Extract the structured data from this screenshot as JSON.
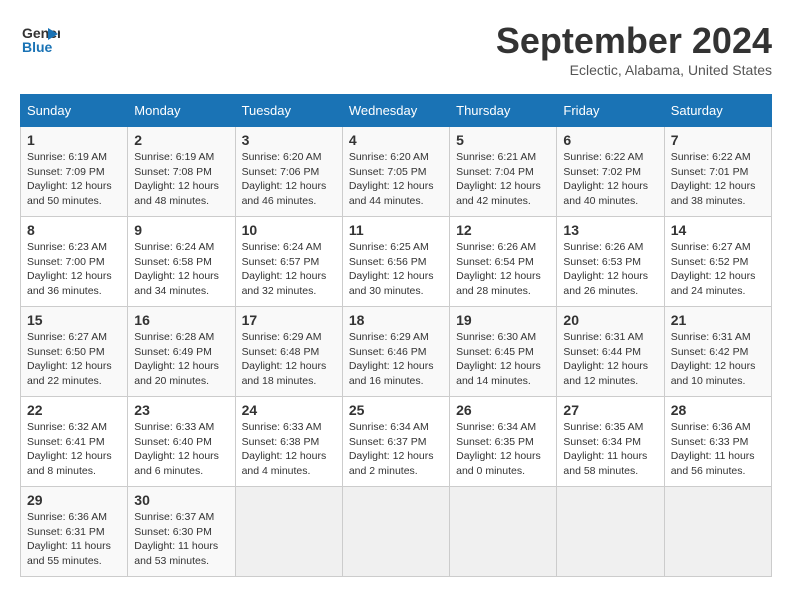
{
  "logo": {
    "line1": "General",
    "line2": "Blue"
  },
  "title": "September 2024",
  "location": "Eclectic, Alabama, United States",
  "days_of_week": [
    "Sunday",
    "Monday",
    "Tuesday",
    "Wednesday",
    "Thursday",
    "Friday",
    "Saturday"
  ],
  "weeks": [
    [
      {
        "day": "1",
        "info": "Sunrise: 6:19 AM\nSunset: 7:09 PM\nDaylight: 12 hours\nand 50 minutes."
      },
      {
        "day": "2",
        "info": "Sunrise: 6:19 AM\nSunset: 7:08 PM\nDaylight: 12 hours\nand 48 minutes."
      },
      {
        "day": "3",
        "info": "Sunrise: 6:20 AM\nSunset: 7:06 PM\nDaylight: 12 hours\nand 46 minutes."
      },
      {
        "day": "4",
        "info": "Sunrise: 6:20 AM\nSunset: 7:05 PM\nDaylight: 12 hours\nand 44 minutes."
      },
      {
        "day": "5",
        "info": "Sunrise: 6:21 AM\nSunset: 7:04 PM\nDaylight: 12 hours\nand 42 minutes."
      },
      {
        "day": "6",
        "info": "Sunrise: 6:22 AM\nSunset: 7:02 PM\nDaylight: 12 hours\nand 40 minutes."
      },
      {
        "day": "7",
        "info": "Sunrise: 6:22 AM\nSunset: 7:01 PM\nDaylight: 12 hours\nand 38 minutes."
      }
    ],
    [
      {
        "day": "8",
        "info": "Sunrise: 6:23 AM\nSunset: 7:00 PM\nDaylight: 12 hours\nand 36 minutes."
      },
      {
        "day": "9",
        "info": "Sunrise: 6:24 AM\nSunset: 6:58 PM\nDaylight: 12 hours\nand 34 minutes."
      },
      {
        "day": "10",
        "info": "Sunrise: 6:24 AM\nSunset: 6:57 PM\nDaylight: 12 hours\nand 32 minutes."
      },
      {
        "day": "11",
        "info": "Sunrise: 6:25 AM\nSunset: 6:56 PM\nDaylight: 12 hours\nand 30 minutes."
      },
      {
        "day": "12",
        "info": "Sunrise: 6:26 AM\nSunset: 6:54 PM\nDaylight: 12 hours\nand 28 minutes."
      },
      {
        "day": "13",
        "info": "Sunrise: 6:26 AM\nSunset: 6:53 PM\nDaylight: 12 hours\nand 26 minutes."
      },
      {
        "day": "14",
        "info": "Sunrise: 6:27 AM\nSunset: 6:52 PM\nDaylight: 12 hours\nand 24 minutes."
      }
    ],
    [
      {
        "day": "15",
        "info": "Sunrise: 6:27 AM\nSunset: 6:50 PM\nDaylight: 12 hours\nand 22 minutes."
      },
      {
        "day": "16",
        "info": "Sunrise: 6:28 AM\nSunset: 6:49 PM\nDaylight: 12 hours\nand 20 minutes."
      },
      {
        "day": "17",
        "info": "Sunrise: 6:29 AM\nSunset: 6:48 PM\nDaylight: 12 hours\nand 18 minutes."
      },
      {
        "day": "18",
        "info": "Sunrise: 6:29 AM\nSunset: 6:46 PM\nDaylight: 12 hours\nand 16 minutes."
      },
      {
        "day": "19",
        "info": "Sunrise: 6:30 AM\nSunset: 6:45 PM\nDaylight: 12 hours\nand 14 minutes."
      },
      {
        "day": "20",
        "info": "Sunrise: 6:31 AM\nSunset: 6:44 PM\nDaylight: 12 hours\nand 12 minutes."
      },
      {
        "day": "21",
        "info": "Sunrise: 6:31 AM\nSunset: 6:42 PM\nDaylight: 12 hours\nand 10 minutes."
      }
    ],
    [
      {
        "day": "22",
        "info": "Sunrise: 6:32 AM\nSunset: 6:41 PM\nDaylight: 12 hours\nand 8 minutes."
      },
      {
        "day": "23",
        "info": "Sunrise: 6:33 AM\nSunset: 6:40 PM\nDaylight: 12 hours\nand 6 minutes."
      },
      {
        "day": "24",
        "info": "Sunrise: 6:33 AM\nSunset: 6:38 PM\nDaylight: 12 hours\nand 4 minutes."
      },
      {
        "day": "25",
        "info": "Sunrise: 6:34 AM\nSunset: 6:37 PM\nDaylight: 12 hours\nand 2 minutes."
      },
      {
        "day": "26",
        "info": "Sunrise: 6:34 AM\nSunset: 6:35 PM\nDaylight: 12 hours\nand 0 minutes."
      },
      {
        "day": "27",
        "info": "Sunrise: 6:35 AM\nSunset: 6:34 PM\nDaylight: 11 hours\nand 58 minutes."
      },
      {
        "day": "28",
        "info": "Sunrise: 6:36 AM\nSunset: 6:33 PM\nDaylight: 11 hours\nand 56 minutes."
      }
    ],
    [
      {
        "day": "29",
        "info": "Sunrise: 6:36 AM\nSunset: 6:31 PM\nDaylight: 11 hours\nand 55 minutes."
      },
      {
        "day": "30",
        "info": "Sunrise: 6:37 AM\nSunset: 6:30 PM\nDaylight: 11 hours\nand 53 minutes."
      },
      {
        "day": "",
        "info": ""
      },
      {
        "day": "",
        "info": ""
      },
      {
        "day": "",
        "info": ""
      },
      {
        "day": "",
        "info": ""
      },
      {
        "day": "",
        "info": ""
      }
    ]
  ]
}
